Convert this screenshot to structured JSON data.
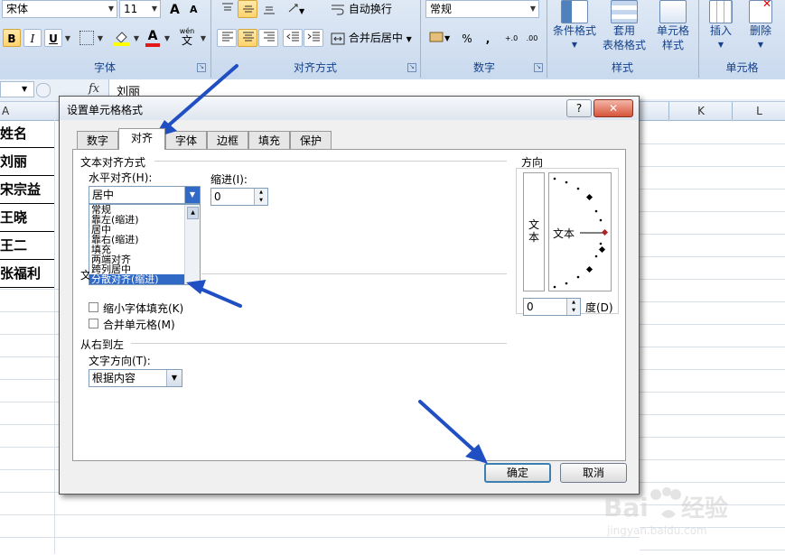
{
  "ribbon": {
    "font_name": "宋体",
    "font_size": "11",
    "font_buttons": {
      "grow": "A",
      "shrink": "A",
      "bold": "B",
      "italic": "I",
      "underline": "U",
      "font_color": "A",
      "phonetic": "wén"
    },
    "wrap_text": "自动换行",
    "merge_center": "合并后居中",
    "number_format": "常规",
    "number_buttons": {
      "percent": "%",
      "comma": ",",
      "inc_decimal": "+.0",
      "dec_decimal": ".00"
    },
    "conditional_format": "条件格式",
    "table_format_1": "套用",
    "table_format_2": "表格格式",
    "cell_style_1": "单元格",
    "cell_style_2": "样式",
    "insert": "插入",
    "delete": "删除",
    "groups": {
      "font": "字体",
      "alignment": "对齐方式",
      "number": "数字",
      "styles": "样式",
      "cells": "单元格"
    }
  },
  "formula_bar": {
    "fx": "fx",
    "value": "刘丽"
  },
  "sheet": {
    "col_headers": [
      "A",
      "K",
      "L"
    ],
    "cells": [
      "姓名",
      "刘丽",
      "宋宗益",
      "王晓",
      "王二",
      "张福利"
    ]
  },
  "dialog": {
    "title": "设置单元格格式",
    "help": "?",
    "close": "✕",
    "tabs": [
      "数字",
      "对齐",
      "字体",
      "边框",
      "填充",
      "保护"
    ],
    "active_tab": "对齐",
    "text_align_section": "文本对齐方式",
    "horizontal_label": "水平对齐(H):",
    "horizontal_value": "居中",
    "horizontal_options": [
      "常规",
      "靠左(缩进)",
      "居中",
      "靠右(缩进)",
      "填充",
      "两端对齐",
      "跨列居中",
      "分散对齐(缩进)"
    ],
    "highlighted_option": "分散对齐(缩进)",
    "indent_label": "缩进(I):",
    "indent_value": "0",
    "text_control_section_partial": "文",
    "shrink_to_fit": "缩小字体填充(K)",
    "merge_cells": "合并单元格(M)",
    "rtl_section": "从右到左",
    "text_direction_label": "文字方向(T):",
    "text_direction_value": "根据内容",
    "orientation_section": "方向",
    "orientation_vertical_text": "文本",
    "orientation_horizontal_text": "文本",
    "degree_value": "0",
    "degree_label": "度(D)",
    "ok": "确定",
    "cancel": "取消"
  },
  "colors": {
    "arrow": "#1f4fc2",
    "highlight": "#3169c6",
    "ribbon_label": "#15428b"
  }
}
